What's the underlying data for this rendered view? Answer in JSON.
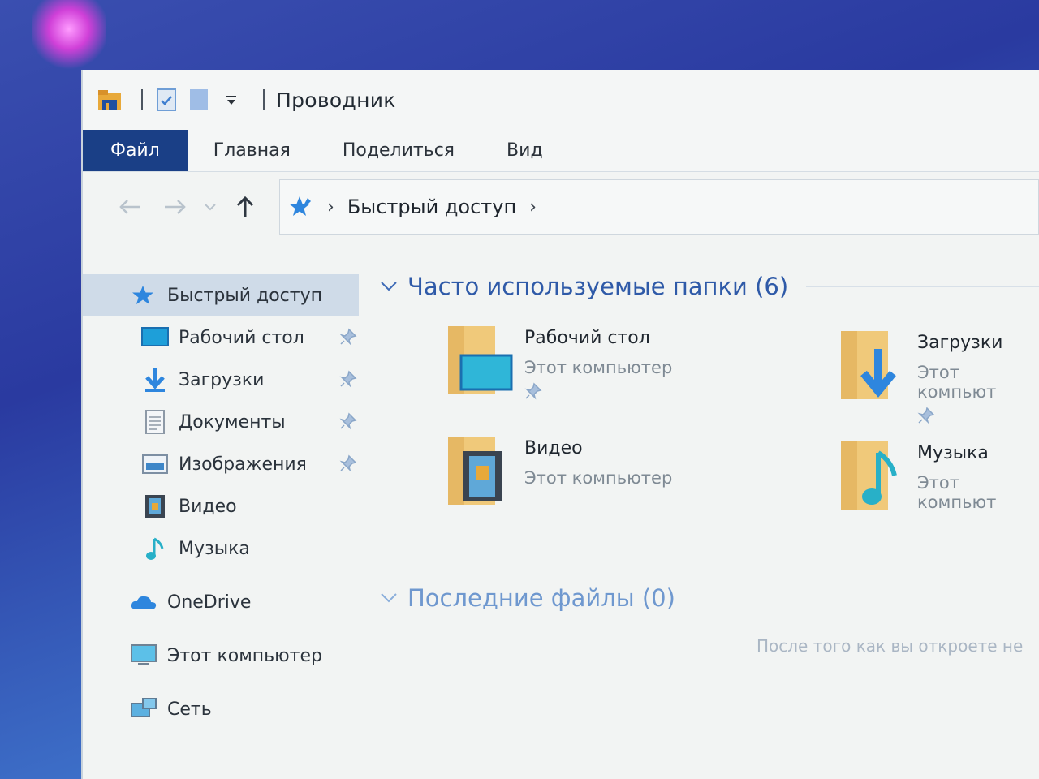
{
  "window": {
    "title": "Проводник"
  },
  "ribbon": {
    "tabs": [
      "Файл",
      "Главная",
      "Поделиться",
      "Вид"
    ]
  },
  "address": {
    "crumbs": [
      "Быстрый доступ"
    ]
  },
  "navpane": {
    "quick_access": "Быстрый доступ",
    "items": [
      {
        "label": "Рабочий стол",
        "icon": "desktop-icon",
        "pinned": true
      },
      {
        "label": "Загрузки",
        "icon": "download-icon",
        "pinned": true
      },
      {
        "label": "Документы",
        "icon": "document-icon",
        "pinned": true
      },
      {
        "label": "Изображения",
        "icon": "pictures-icon",
        "pinned": true
      },
      {
        "label": "Видео",
        "icon": "video-icon",
        "pinned": false
      },
      {
        "label": "Музыка",
        "icon": "music-icon",
        "pinned": false
      }
    ],
    "onedrive": "OneDrive",
    "this_pc": "Этот компьютер",
    "network": "Сеть"
  },
  "main": {
    "frequent_header": "Часто используемые папки (6)",
    "folders": [
      {
        "name": "Рабочий стол",
        "location": "Этот компьютер",
        "pinned": true
      },
      {
        "name": "Загрузки",
        "location": "Этот компьют",
        "pinned": true
      },
      {
        "name": "Видео",
        "location": "Этот компьютер",
        "pinned": false
      },
      {
        "name": "Музыка",
        "location": "Этот компьют",
        "pinned": false
      }
    ],
    "recent_header": "Последние файлы (0)",
    "recent_empty": "После того как вы откроете не"
  },
  "colors": {
    "file_tab": "#1a3f86",
    "header_blue": "#2f5aa8",
    "selection": "#cfdbe8"
  }
}
